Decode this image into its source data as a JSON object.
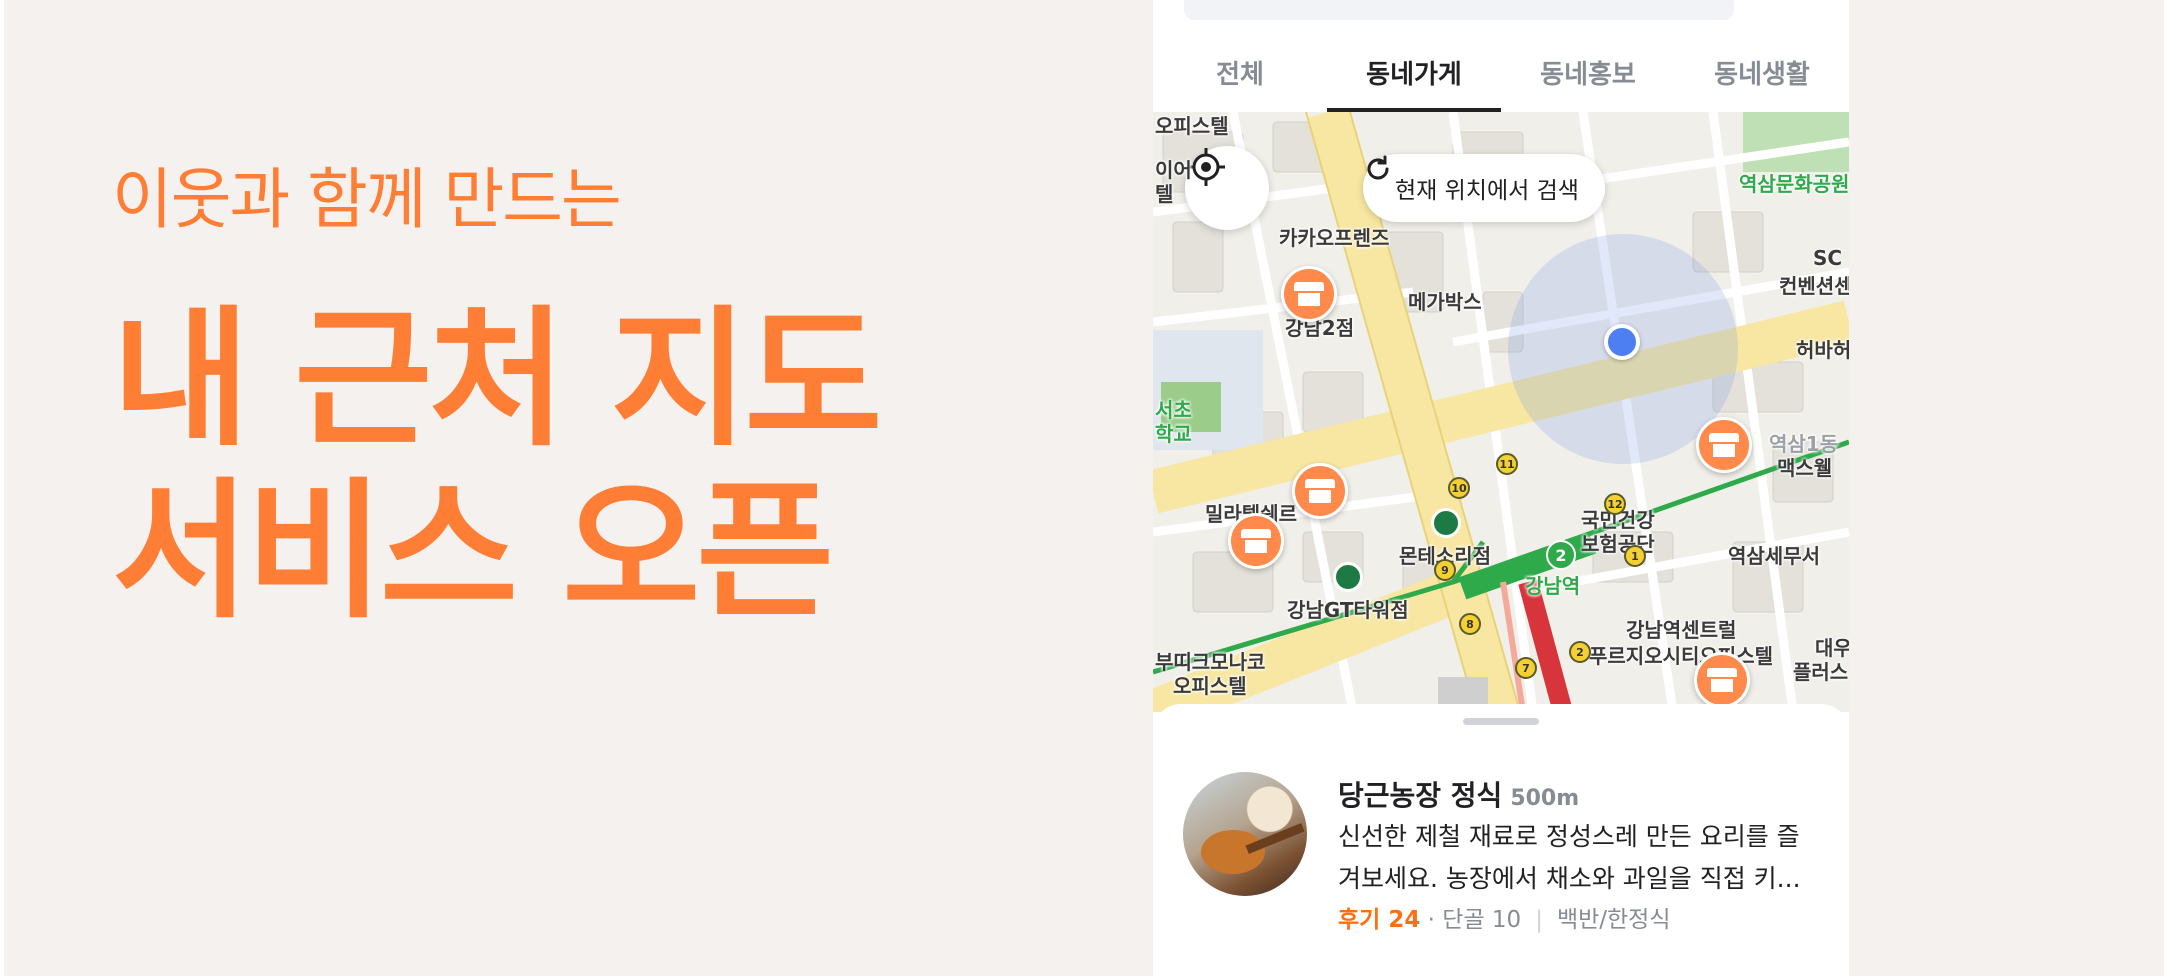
{
  "hero": {
    "subtitle": "이웃과 함께 만드는",
    "headline_line1": "내 근처 지도",
    "headline_line2": "서비스 오픈"
  },
  "tabs": [
    {
      "label": "전체",
      "active": false
    },
    {
      "label": "동네가게",
      "active": true
    },
    {
      "label": "동네홍보",
      "active": false
    },
    {
      "label": "동네생활",
      "active": false
    }
  ],
  "map": {
    "research_label": "현재 위치에서 검색",
    "labels": {
      "officetel_top": "오피스텔",
      "kakao": "카카오프렌즈",
      "megabox": "메가박스",
      "gangnam2": "강남2점",
      "seocho": "서초",
      "school": "학교",
      "milatel": "밀라텔쉐르",
      "montessori": "몬테소리점",
      "gangnamgt": "강남GT타워점",
      "gangnam_station": "강남역",
      "nhis1": "국민건강",
      "nhis2": "보험공단",
      "yeoksam_tax": "역삼세무서",
      "central": "강남역센트럴",
      "prugio": "푸르지오시티오피스텔",
      "boutique": "부띠크모나코",
      "officetel_bottom": "오피스텔",
      "yeoksam_park": "역삼문화공원",
      "sc": "SC",
      "convention": "컨벤션센",
      "heo": "허바허",
      "yeoksam1": "역삼1동",
      "max": "맥스웰",
      "daewoo": "대우",
      "plus": "플러스",
      "io": "이어",
      "tel": "텔"
    },
    "metro_numbers": [
      "11",
      "10",
      "9",
      "8",
      "7",
      "12",
      "1",
      "2"
    ],
    "line2_badge": "2"
  },
  "sheet": {
    "store_name": "당근농장 정식",
    "distance": "500m",
    "description": "신선한 제철 재료로 정성스레 만든 요리를 즐겨보세요. 농장에서 채소와 과일을 직접 키...",
    "review": "후기 24",
    "regulars": "단골 10",
    "category": "백반/한정식"
  },
  "colors": {
    "brand": "#ff7e36",
    "location": "#4d7ef2",
    "line2": "#2eaa4b"
  }
}
